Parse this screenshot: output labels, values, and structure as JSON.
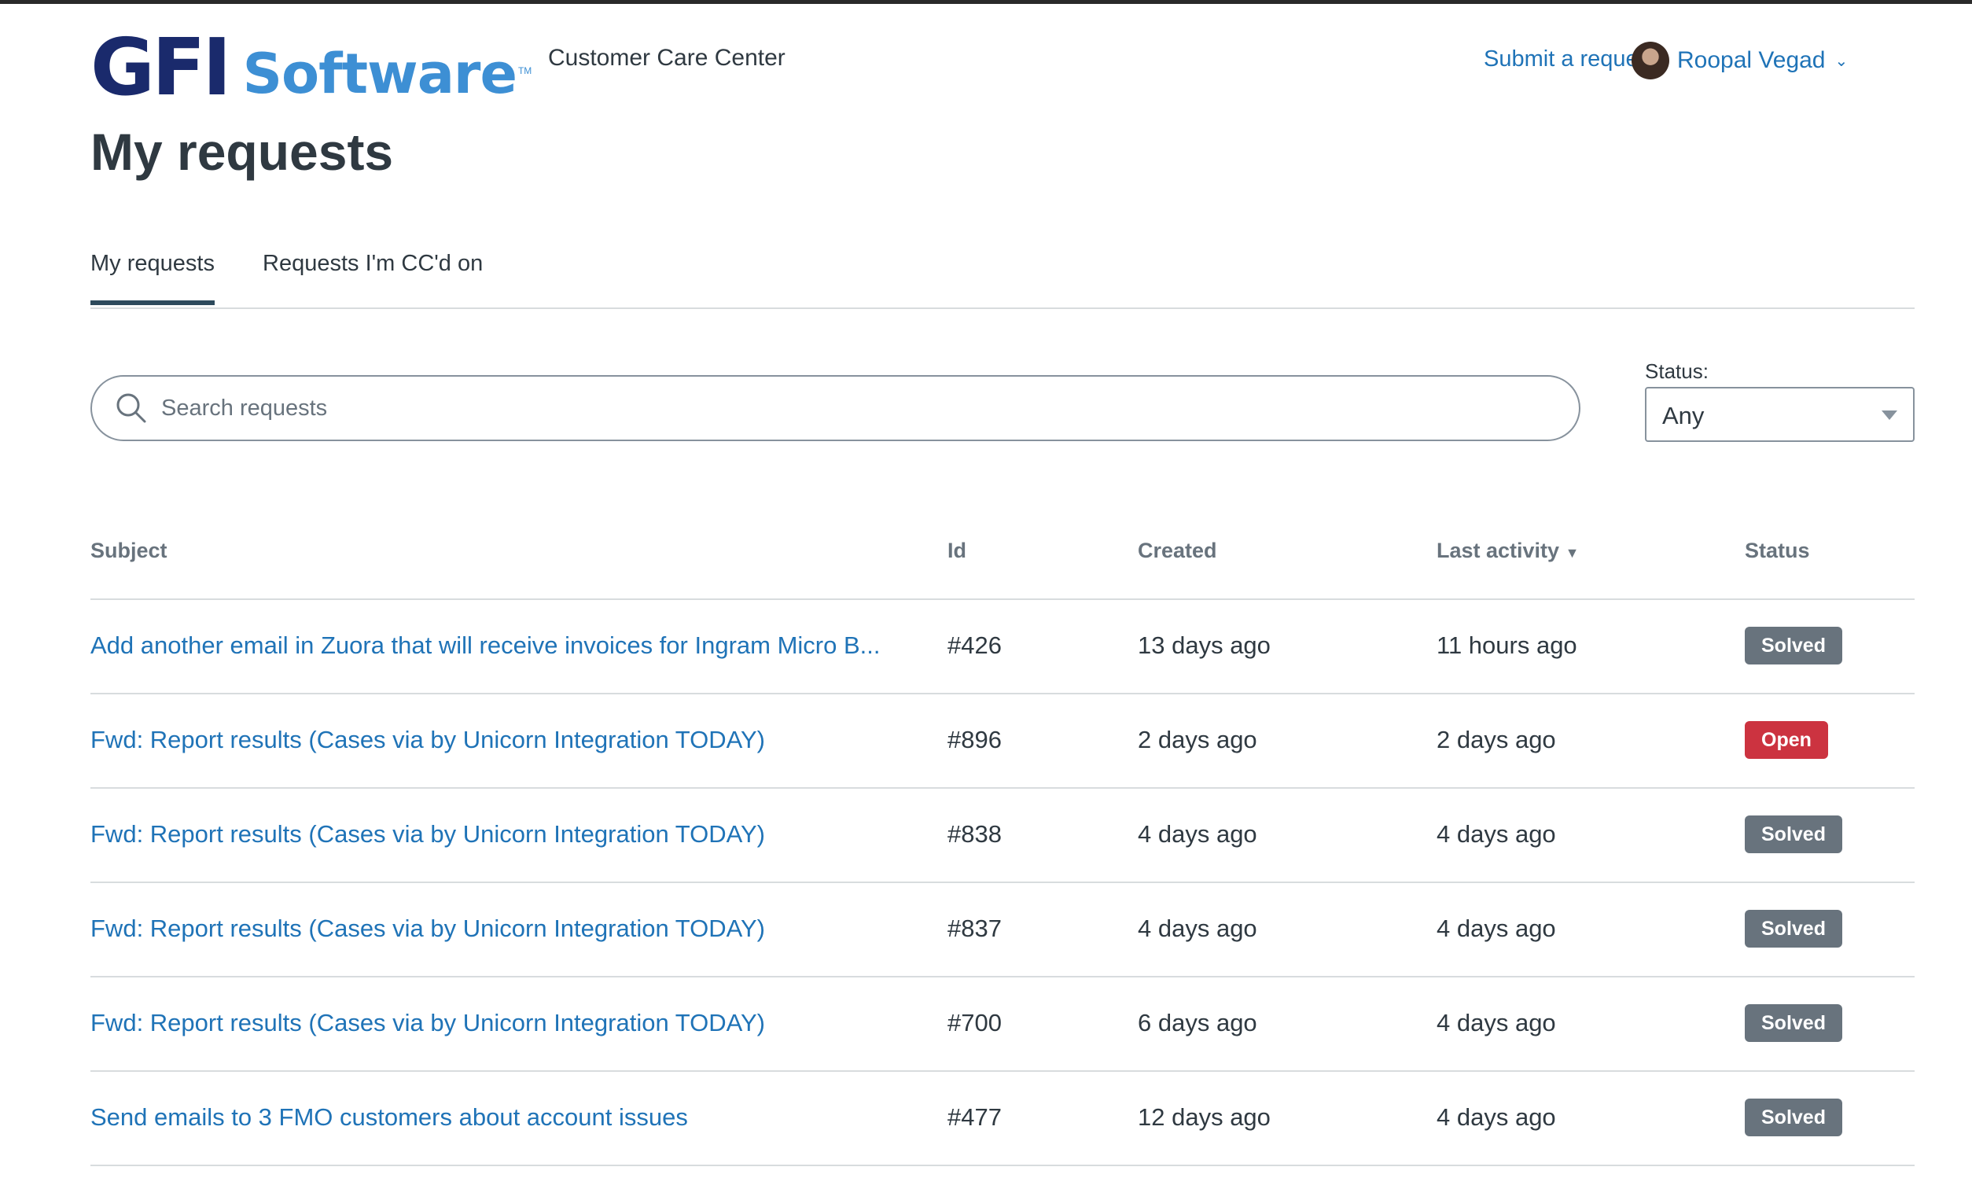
{
  "header": {
    "logo_primary": "GFI",
    "logo_secondary": "Software",
    "logo_tm": "TM",
    "brand_text": "Customer Care Center",
    "submit_link": "Submit a request",
    "user_name": "Roopal Vegad",
    "user_chevron_icon": "chevron-down-icon"
  },
  "page": {
    "title": "My requests"
  },
  "tabs": [
    {
      "label": "My requests",
      "active": true
    },
    {
      "label": "Requests I'm CC'd on",
      "active": false
    }
  ],
  "search": {
    "placeholder": "Search requests",
    "value": "",
    "icon": "search-icon"
  },
  "status_filter": {
    "label": "Status:",
    "value": "Any"
  },
  "table": {
    "headers": {
      "subject": "Subject",
      "id": "Id",
      "created": "Created",
      "last_activity": "Last activity",
      "last_activity_sort_indicator": "▼",
      "status": "Status"
    },
    "rows": [
      {
        "subject": "Add another email in Zuora that will receive invoices for Ingram Micro B...",
        "id": "#426",
        "created": "13 days ago",
        "last_activity": "11 hours ago",
        "status": "Solved"
      },
      {
        "subject": "Fwd: Report results (Cases via by Unicorn Integration TODAY)",
        "id": "#896",
        "created": "2 days ago",
        "last_activity": "2 days ago",
        "status": "Open"
      },
      {
        "subject": "Fwd: Report results (Cases via by Unicorn Integration TODAY)",
        "id": "#838",
        "created": "4 days ago",
        "last_activity": "4 days ago",
        "status": "Solved"
      },
      {
        "subject": "Fwd: Report results (Cases via by Unicorn Integration TODAY)",
        "id": "#837",
        "created": "4 days ago",
        "last_activity": "4 days ago",
        "status": "Solved"
      },
      {
        "subject": "Fwd: Report results (Cases via by Unicorn Integration TODAY)",
        "id": "#700",
        "created": "6 days ago",
        "last_activity": "4 days ago",
        "status": "Solved"
      },
      {
        "subject": "Send emails to 3 FMO customers about account issues",
        "id": "#477",
        "created": "12 days ago",
        "last_activity": "4 days ago",
        "status": "Solved"
      }
    ]
  },
  "colors": {
    "link": "#1f73b7",
    "text": "#2f3941",
    "badge_solved": "#68737d",
    "badge_open": "#cc3340",
    "logo_dark": "#1a2a6c",
    "logo_light": "#3d8fd4"
  }
}
